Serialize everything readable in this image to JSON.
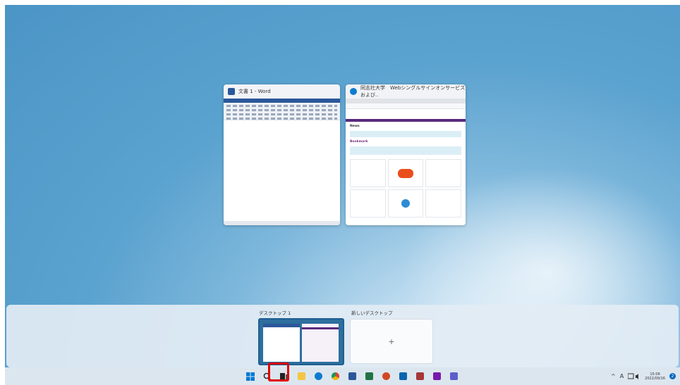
{
  "windows": [
    {
      "title": "文書 1 - Word",
      "app": "word"
    },
    {
      "title": "同志社大学　Webシングルサインオンサービス および..",
      "app": "edge",
      "content": {
        "section1": "News",
        "section2": "Bookmark"
      }
    }
  ],
  "virtual_desktops": {
    "current_label": "デスクトップ 1",
    "new_label": "新しいデスクトップ",
    "new_symbol": "+"
  },
  "taskbar": {
    "icons": [
      "start-icon",
      "search-icon",
      "task-view-icon",
      "file-explorer-icon",
      "edge-icon",
      "chrome-icon",
      "word-icon",
      "excel-icon",
      "powerpoint-icon",
      "outlook-icon",
      "access-icon",
      "onenote-icon",
      "teams-icon"
    ],
    "tray": {
      "chevron": "^",
      "ime": "A",
      "time": "15:06",
      "date": "2022/09/16"
    }
  },
  "colors": {
    "highlight": "#e00000",
    "accent": "#0067c0",
    "word": "#2b579a",
    "edge": "#0f7ccf"
  }
}
